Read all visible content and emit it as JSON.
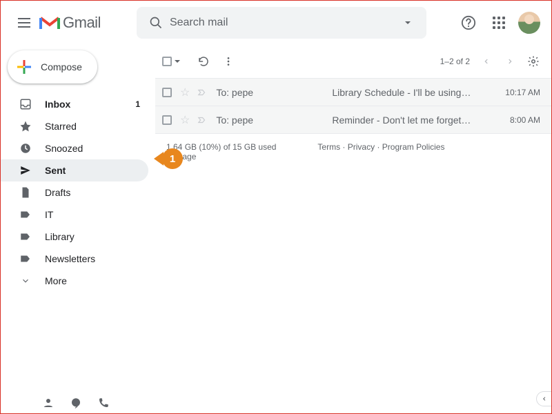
{
  "header": {
    "app_name": "Gmail",
    "search_placeholder": "Search mail"
  },
  "compose_label": "Compose",
  "sidebar": {
    "items": [
      {
        "label": "Inbox",
        "count": "1"
      },
      {
        "label": "Starred"
      },
      {
        "label": "Snoozed"
      },
      {
        "label": "Sent"
      },
      {
        "label": "Drafts"
      },
      {
        "label": "IT"
      },
      {
        "label": "Library"
      },
      {
        "label": "Newsletters"
      },
      {
        "label": "More"
      }
    ]
  },
  "toolbar": {
    "range": "1–2 of 2"
  },
  "messages": [
    {
      "sender": "To: pepe",
      "subject": "Library Schedule",
      "snippet": " - I'll be using…",
      "time": "10:17 AM"
    },
    {
      "sender": "To: pepe",
      "subject": "Reminder",
      "snippet": " - Don't let me forget…",
      "time": "8:00 AM"
    }
  ],
  "footer": {
    "storage_line": "1.64 GB (10%) of 15 GB used",
    "manage": "Manage",
    "terms": "Terms",
    "privacy": "Privacy",
    "policies": "Program Policies"
  },
  "callout": {
    "number": "1"
  }
}
